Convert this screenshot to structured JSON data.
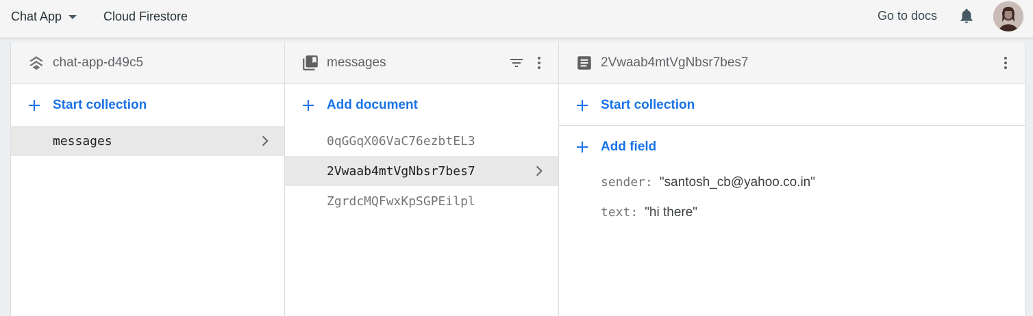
{
  "topbar": {
    "project_name": "Chat App",
    "product_name": "Cloud Firestore",
    "docs_link": "Go to docs",
    "icons": {
      "bell": "notifications-bell-icon",
      "avatar": "user-avatar"
    }
  },
  "root_panel": {
    "title": "chat-app-d49c5",
    "icon": "database-layers-icon",
    "action_label": "Start collection",
    "items": [
      {
        "label": "messages",
        "selected": true
      }
    ]
  },
  "collection_panel": {
    "title": "messages",
    "icon": "collection-icon",
    "action_label": "Add document",
    "items": [
      {
        "label": "0qGGqX06VaC76ezbtEL3",
        "selected": false
      },
      {
        "label": "2Vwaab4mtVgNbsr7bes7",
        "selected": true
      },
      {
        "label": "ZgrdcMQFwxKpSGPEilpl",
        "selected": false
      }
    ]
  },
  "document_panel": {
    "title": "2Vwaab4mtVgNbsr7bes7",
    "icon": "document-icon",
    "start_collection_label": "Start collection",
    "add_field_label": "Add field",
    "fields": [
      {
        "key": "sender:",
        "value": "\"santosh_cb@yahoo.co.in\""
      },
      {
        "key": "text:",
        "value": "\"hi there\""
      }
    ]
  },
  "colors": {
    "accent": "#1a73e8",
    "selected_row": "#e8e8e8",
    "header_bg": "#f5f5f5"
  }
}
